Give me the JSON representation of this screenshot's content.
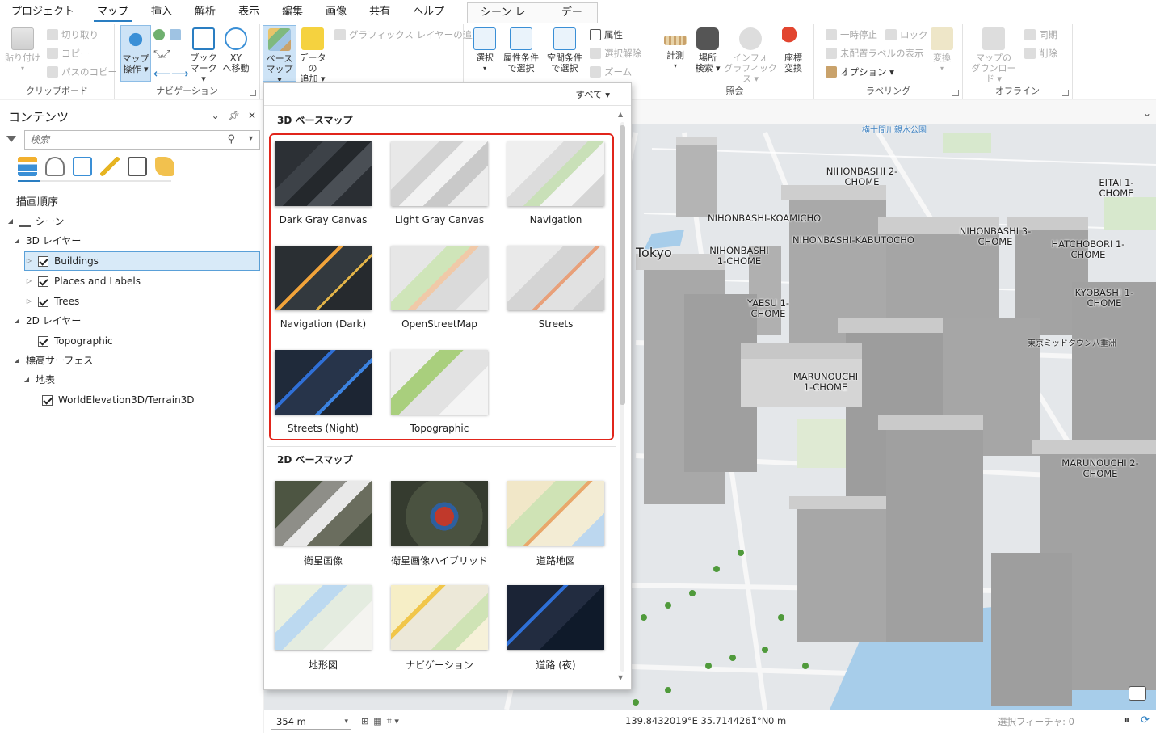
{
  "menu": {
    "tabs": [
      "プロジェクト",
      "マップ",
      "挿入",
      "解析",
      "表示",
      "編集",
      "画像",
      "共有",
      "ヘルプ"
    ],
    "active": "マップ",
    "contextual_tabs": [
      "シーン レイヤー",
      "データ"
    ]
  },
  "ribbon": {
    "clipboard": {
      "paste": "貼り付け",
      "cut": "切り取り",
      "copy": "コピー",
      "copy_path": "パスのコピー",
      "group": "クリップボード"
    },
    "navigation": {
      "explore_l1": "マップ",
      "explore_l2": "操作",
      "bookmark_l1": "ブック",
      "bookmark_l2": "マーク",
      "xy_l1": "XY",
      "xy_l2": "へ移動",
      "group": "ナビゲーション"
    },
    "layer": {
      "basemap_l1": "ベース",
      "basemap_l2": "マップ",
      "adddata_l1": "データの",
      "adddata_l2": "追加",
      "add_graphics": "グラフィックス レイヤーの追加"
    },
    "selection": {
      "select": "選択",
      "by_attr_l1": "属性条件",
      "by_attr_l2": "で選択",
      "by_loc_l1": "空間条件",
      "by_loc_l2": "で選択",
      "attributes": "属性",
      "clear": "選択解除",
      "zoom": "ズーム"
    },
    "inquiry": {
      "measure": "計測",
      "locate_l1": "場所",
      "locate_l2": "検索",
      "infographics_l1": "インフォ",
      "infographics_l2": "グラフィックス",
      "coord_l1": "座標",
      "coord_l2": "変換",
      "group": "照会"
    },
    "labeling": {
      "pause": "一時停止",
      "lock": "ロック",
      "unplaced": "未配置ラベルの表示",
      "options": "オプション",
      "convert": "変換",
      "group": "ラベリング"
    },
    "offline": {
      "download_l1": "マップの",
      "download_l2": "ダウンロード",
      "sync": "同期",
      "remove": "削除",
      "group": "オフライン"
    }
  },
  "contents": {
    "title": "コンテンツ",
    "search_placeholder": "検索",
    "draw_order": "描画順序",
    "tree": [
      {
        "label": "シーン",
        "level": 0,
        "type": "scene"
      },
      {
        "label": "3D レイヤー",
        "level": 1,
        "type": "group"
      },
      {
        "label": "Buildings",
        "level": 2,
        "type": "layer",
        "checked": true,
        "selected": true
      },
      {
        "label": "Places and Labels",
        "level": 2,
        "type": "layer",
        "checked": true
      },
      {
        "label": "Trees",
        "level": 2,
        "type": "layer",
        "checked": true
      },
      {
        "label": "2D レイヤー",
        "level": 1,
        "type": "group"
      },
      {
        "label": "Topographic",
        "level": 2,
        "type": "layer",
        "checked": true
      },
      {
        "label": "標高サーフェス",
        "level": 1,
        "type": "group"
      },
      {
        "label": "地表",
        "level": 2,
        "type": "group"
      },
      {
        "label": "WorldElevation3D/Terrain3D",
        "level": 3,
        "type": "layer",
        "checked": true
      }
    ]
  },
  "gallery": {
    "filter": "すべて",
    "section_3d": "3D ベースマップ",
    "section_2d": "2D ベースマップ",
    "items_3d": [
      "Dark Gray Canvas",
      "Light Gray Canvas",
      "Navigation",
      "Navigation (Dark)",
      "OpenStreetMap",
      "Streets",
      "Streets (Night)",
      "Topographic"
    ],
    "items_2d": [
      "衛星画像",
      "衛星画像ハイブリッド",
      "道路地図",
      "地形図",
      "ナビゲーション",
      "道路 (夜)"
    ]
  },
  "map": {
    "labels": [
      "NIHONBASHI 2-CHOME",
      "EITAI 1-CHOME",
      "NIHONBASHI-KOAMICHO",
      "NIHONBASHI-KABUTOCHO",
      "NIHONBASHI 3-CHOME",
      "HATCHOBORI 1-CHOME",
      "Tokyo",
      "NIHONBASHI 1-CHOME",
      "YAESU 1-CHOME",
      "KYOBASHI 1-CHOME",
      "MARUNOUCHI 1-CHOME",
      "MARUNOUCHI 2-CHOME",
      "東京ミッドタウン八重洲",
      "横十間川親水公園"
    ]
  },
  "status": {
    "scale": "354 m",
    "coords": "139.8432019°E 35.7144261°N",
    "elevation": "0 m",
    "selected_features": "選択フィーチャ: 0"
  }
}
